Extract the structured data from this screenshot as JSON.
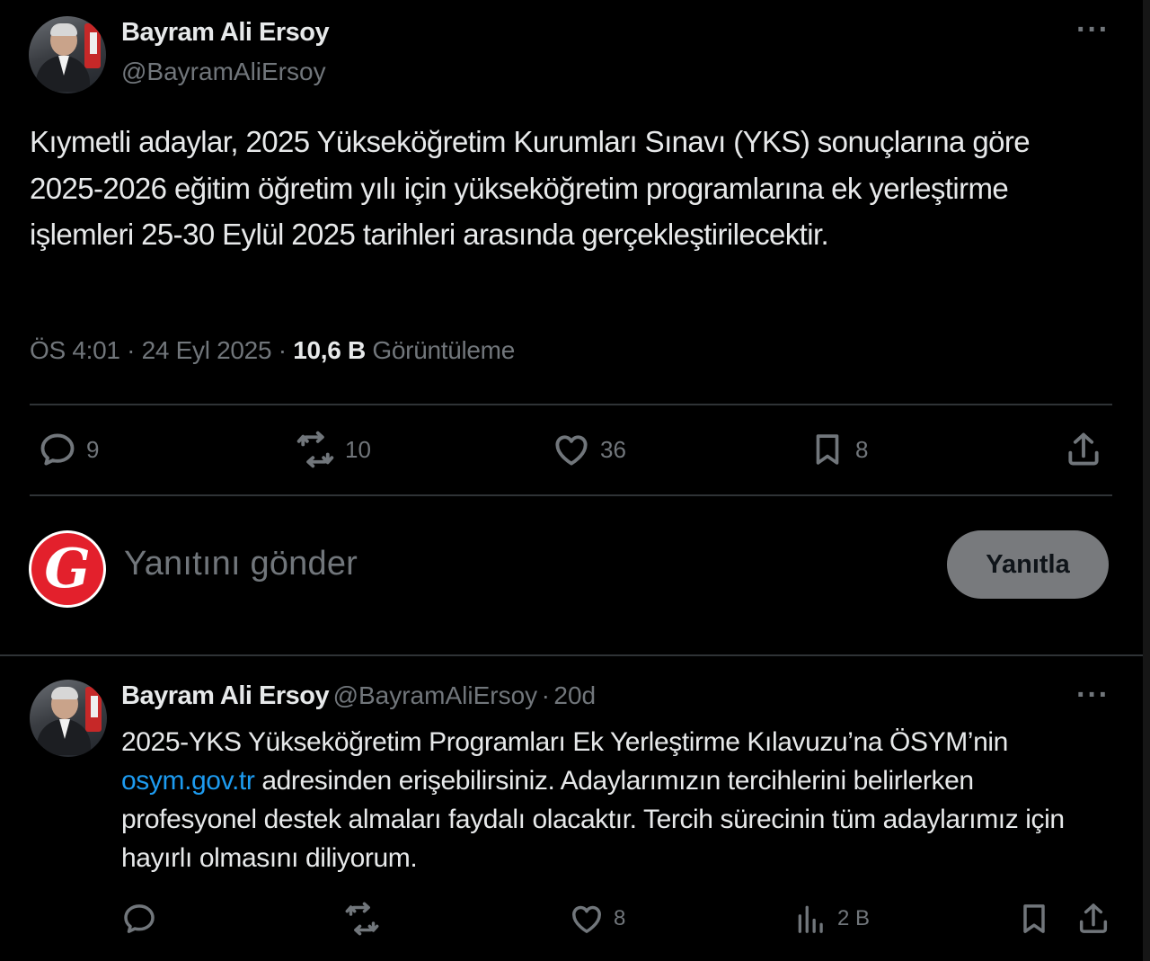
{
  "main_tweet": {
    "author_name": "Bayram Ali Ersoy",
    "author_handle": "@BayramAliErsoy",
    "more_icon": "more-horizontal-icon",
    "text": "Kıymetli adaylar, 2025 Yükseköğretim Kurumları Sınavı (YKS) sonuçlarına göre 2025-2026 eğitim öğretim yılı için yükseköğretim programlarına ek yerleştirme işlemleri 25-30 Eylül 2025 tarihleri arasında gerçekleştirilecektir.",
    "time": "ÖS 4:01",
    "date": "24 Eyl 2025",
    "views_count": "10,6 B",
    "views_label": "Görüntüleme",
    "separator": "·",
    "actions": {
      "reply_count": "9",
      "retweet_count": "10",
      "like_count": "36",
      "bookmark_count": "8"
    }
  },
  "compose": {
    "placeholder": "Yanıtını gönder",
    "button_label": "Yanıtla",
    "avatar_letter": "G",
    "avatar_color": "#e3202c"
  },
  "reply_tweet": {
    "author_name": "Bayram Ali Ersoy",
    "author_handle": "@BayramAliErsoy",
    "time_ago": "20d",
    "separator": "·",
    "text_before_link": "2025-YKS Yükseköğretim Programları Ek Yerleştirme Kılavuzu’na ÖSYM’nin",
    "link_text": "osym.gov.tr",
    "text_after_link": " adresinden erişebilirsiniz. Adaylarımızın tercihlerini belirlerken profesyonel destek almaları faydalı olacaktır. Tercih sürecinin tüm adaylarımız için hayırlı olmasını diliyorum.",
    "actions": {
      "reply_count": "",
      "retweet_count": "",
      "like_count": "8",
      "views_count": "2 B"
    }
  },
  "colors": {
    "background": "#000000",
    "text_primary": "#e7e9ea",
    "text_secondary": "#71767b",
    "link": "#1d9bf0",
    "divider": "#2f3336"
  }
}
